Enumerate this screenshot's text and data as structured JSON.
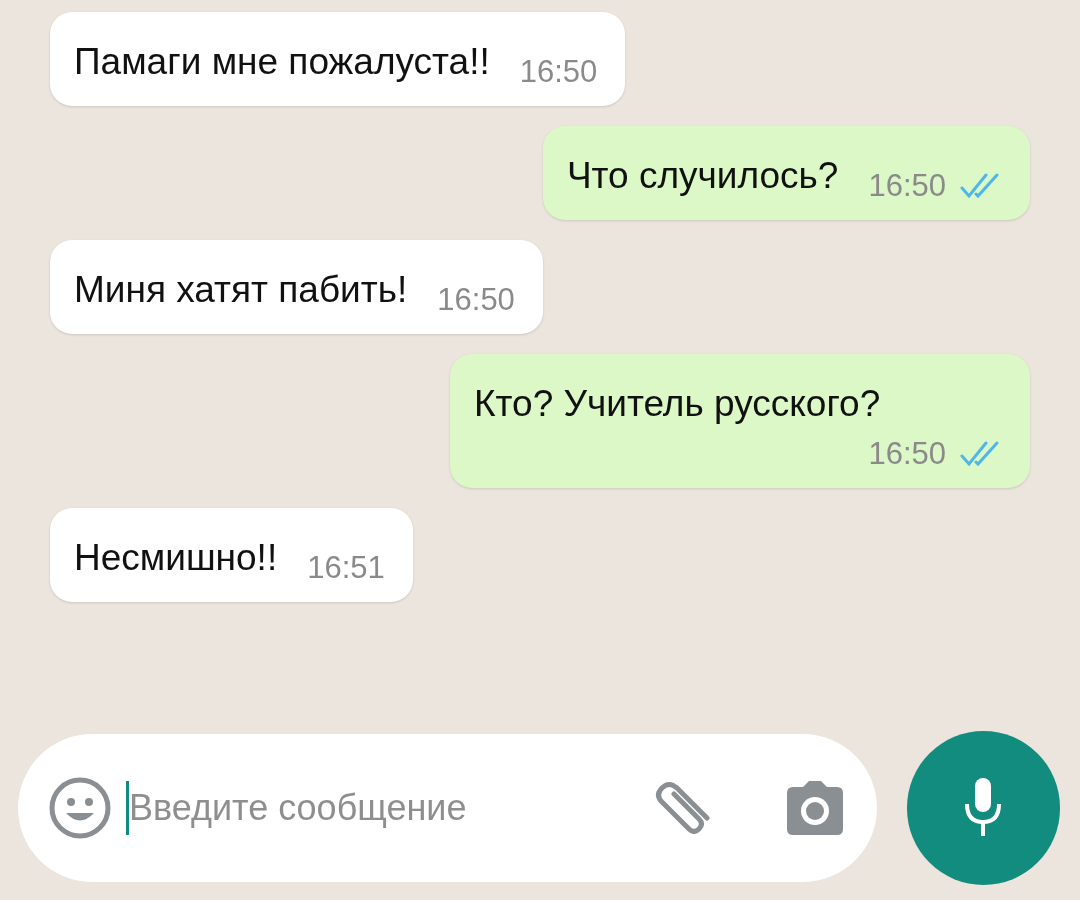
{
  "messages": [
    {
      "kind": "incoming",
      "text": "Памаги мне пожалуста!!",
      "time": "16:50"
    },
    {
      "kind": "outgoing",
      "text": "Что случилось?",
      "time": "16:50",
      "read": true
    },
    {
      "kind": "incoming",
      "text": "Миня хатят пабить!",
      "time": "16:50"
    },
    {
      "kind": "outgoing",
      "text": "Кто? Учитель русского?",
      "time": "16:50",
      "read": true
    },
    {
      "kind": "incoming",
      "text": "Несмишно!!",
      "time": "16:51"
    }
  ],
  "composer": {
    "placeholder": "Введите сообщение"
  }
}
